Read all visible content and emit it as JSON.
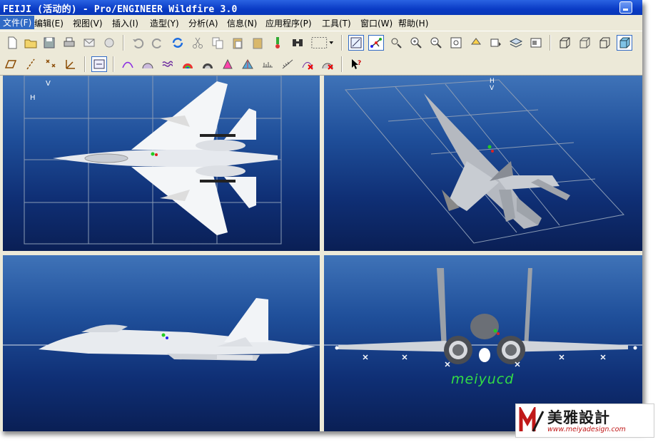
{
  "window": {
    "title": "FEIJI (活动的) - Pro/ENGINEER Wildfire 3.0"
  },
  "menu": {
    "items": [
      {
        "label": "文件(F)"
      },
      {
        "label": "编辑(E)"
      },
      {
        "label": "视图(V)"
      },
      {
        "label": "插入(I)"
      },
      {
        "label": "造型(Y)"
      },
      {
        "label": "分析(A)"
      },
      {
        "label": "信息(N)"
      },
      {
        "label": "应用程序(P)"
      },
      {
        "label": "工具(T)"
      },
      {
        "label": "窗口(W)"
      },
      {
        "label": "帮助(H)"
      }
    ]
  },
  "viewports": {
    "top_left": {
      "view": "top",
      "axis_labels": [
        "H",
        "V"
      ]
    },
    "top_right": {
      "view": "isometric",
      "axis_labels": [
        "H",
        "V"
      ]
    },
    "bottom_left": {
      "view": "side"
    },
    "bottom_right": {
      "view": "front",
      "annotation": "meiyucd"
    }
  },
  "watermark": {
    "brand": "美雅設計",
    "url": "www.meiyadesign.com"
  },
  "colors": {
    "titlebar": "#0a3bc5",
    "viewport_top": "#3f73b8",
    "viewport_bottom": "#0a1f55",
    "annotation": "#33dd44"
  }
}
